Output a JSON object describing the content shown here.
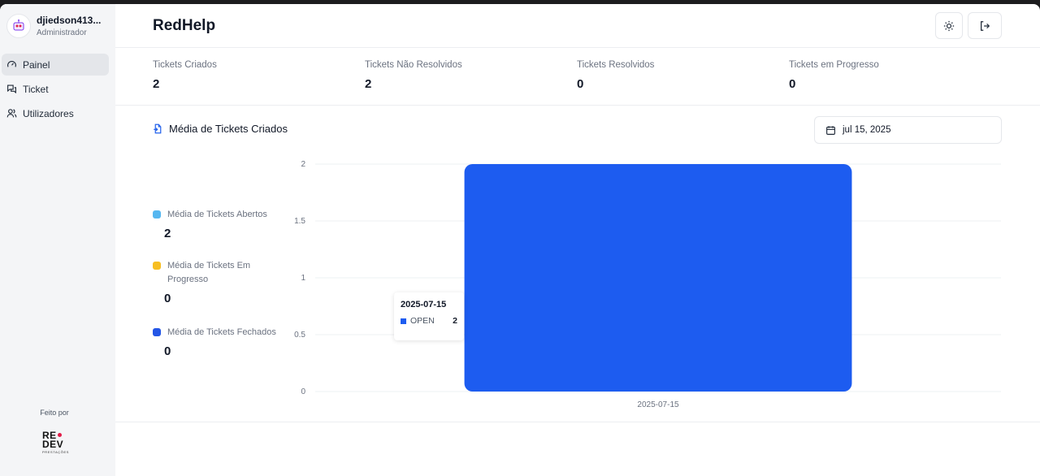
{
  "user": {
    "name": "djiedson413...",
    "role": "Administrador"
  },
  "sidebar": {
    "items": [
      {
        "label": "Painel",
        "icon": "gauge-icon",
        "active": true
      },
      {
        "label": "Ticket",
        "icon": "chat-icon",
        "active": false
      },
      {
        "label": "Utilizadores",
        "icon": "users-icon",
        "active": false
      }
    ],
    "made_by": "Feito por",
    "logo": {
      "line1": "RE",
      "line2": "DEV",
      "sub": "PRESTAÇÕES"
    }
  },
  "header": {
    "title": "RedHelp",
    "theme_icon": "sun-icon",
    "logout_icon": "logout-icon"
  },
  "stats": [
    {
      "label": "Tickets Criados",
      "value": "2"
    },
    {
      "label": "Tickets Não Resolvidos",
      "value": "2"
    },
    {
      "label": "Tickets Resolvidos",
      "value": "0"
    },
    {
      "label": "Tickets em Progresso",
      "value": "0"
    }
  ],
  "section": {
    "title": "Média de Tickets Criados",
    "date": "jul 15, 2025"
  },
  "legend": [
    {
      "label": "Média de Tickets Abertos",
      "value": "2",
      "color": "#56b7f0"
    },
    {
      "label": "Média de Tickets Em Progresso",
      "value": "0",
      "color": "#f7be22"
    },
    {
      "label": "Média de Tickets Fechados",
      "value": "0",
      "color": "#2456e6"
    }
  ],
  "tooltip": {
    "title": "2025-07-15",
    "series": "OPEN",
    "value": "2"
  },
  "colors": {
    "bar": "#1d5cf0",
    "grid": "#eef0f3"
  },
  "chart_data": {
    "type": "bar",
    "categories": [
      "2025-07-15"
    ],
    "series": [
      {
        "name": "OPEN",
        "values": [
          2
        ]
      }
    ],
    "ylim": [
      0,
      2
    ],
    "yticks": [
      "0",
      "0.5",
      "1",
      "1.5",
      "2"
    ],
    "grid": true
  }
}
